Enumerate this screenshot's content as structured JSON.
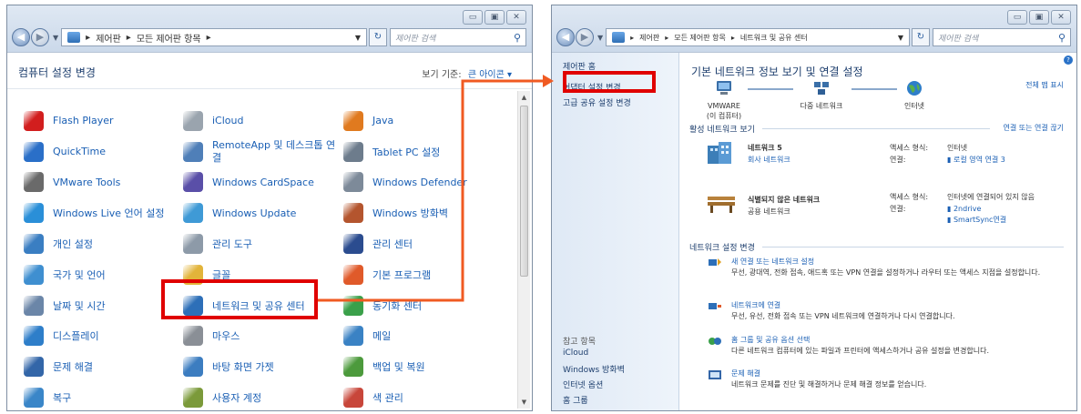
{
  "left_window": {
    "caption_buttons": [
      "▭",
      "▣",
      "✕"
    ],
    "address": {
      "crumbs": [
        "제어판",
        "모든 제어판 항목"
      ],
      "search_placeholder": "제어판 검색"
    },
    "title": "컴퓨터 설정 변경",
    "view_by_label": "보기 기준:",
    "view_by_value": "큰 아이콘 ▾",
    "items": [
      {
        "label": "Flash Player",
        "icon": "flash-player-icon",
        "color": "#d21e1e"
      },
      {
        "label": "iCloud",
        "icon": "icloud-icon",
        "color": "#9aa4ae"
      },
      {
        "label": "Java",
        "icon": "java-icon",
        "color": "#e07a1f"
      },
      {
        "label": "QuickTime",
        "icon": "quicktime-icon",
        "color": "#2a6fc8"
      },
      {
        "label": "RemoteApp 및 데스크톱 연결",
        "icon": "remoteapp-icon",
        "color": "#4f7fb8"
      },
      {
        "label": "Tablet PC 설정",
        "icon": "tablet-pc-icon",
        "color": "#6d7c8c"
      },
      {
        "label": "VMware Tools",
        "icon": "vmware-icon",
        "color": "#6a6a6a"
      },
      {
        "label": "Windows CardSpace",
        "icon": "cardspace-icon",
        "color": "#5a4fa8"
      },
      {
        "label": "Windows Defender",
        "icon": "defender-icon",
        "color": "#7d8a99"
      },
      {
        "label": "Windows Live 언어 설정",
        "icon": "windows-live-icon",
        "color": "#2a8fd8"
      },
      {
        "label": "Windows Update",
        "icon": "windows-update-icon",
        "color": "#3f9ad6"
      },
      {
        "label": "Windows 방화벽",
        "icon": "firewall-icon",
        "color": "#b4552e"
      },
      {
        "label": "개인 설정",
        "icon": "personalization-icon",
        "color": "#3a7ec2"
      },
      {
        "label": "관리 도구",
        "icon": "admin-tools-icon",
        "color": "#8d9aa8"
      },
      {
        "label": "관리 센터",
        "icon": "action-center-icon",
        "color": "#2b4c8f"
      },
      {
        "label": "국가 및 언어",
        "icon": "region-language-icon",
        "color": "#3f8fd0"
      },
      {
        "label": "글꼴",
        "icon": "fonts-icon",
        "color": "#e2b43a"
      },
      {
        "label": "기본 프로그램",
        "icon": "default-programs-icon",
        "color": "#e05a2a"
      },
      {
        "label": "날짜 및 시간",
        "icon": "date-time-icon",
        "color": "#6b86a8"
      },
      {
        "label": "네트워크 및 공유 센터",
        "icon": "network-sharing-icon",
        "color": "#2d6fb8"
      },
      {
        "label": "동기화 센터",
        "icon": "sync-center-icon",
        "color": "#3aa04a"
      },
      {
        "label": "디스플레이",
        "icon": "display-icon",
        "color": "#2e7ec9"
      },
      {
        "label": "마우스",
        "icon": "mouse-icon",
        "color": "#8a8f96"
      },
      {
        "label": "메일",
        "icon": "mail-icon",
        "color": "#3a82c4"
      },
      {
        "label": "문제 해결",
        "icon": "troubleshooting-icon",
        "color": "#3366a8"
      },
      {
        "label": "바탕 화면 가젯",
        "icon": "gadgets-icon",
        "color": "#3c7dc0"
      },
      {
        "label": "백업 및 복원",
        "icon": "backup-restore-icon",
        "color": "#4c9a3c"
      },
      {
        "label": "복구",
        "icon": "recovery-icon",
        "color": "#3a86c8"
      },
      {
        "label": "사용자 계정",
        "icon": "user-accounts-icon",
        "color": "#7b9a3a"
      },
      {
        "label": "색 관리",
        "icon": "color-management-icon",
        "color": "#c8463a"
      }
    ]
  },
  "right_window": {
    "caption_buttons": [
      "▭",
      "▣",
      "✕"
    ],
    "address": {
      "crumbs": [
        "제어판",
        "모든 제어판 항목",
        "네트워크 및 공유 센터"
      ],
      "search_placeholder": "제어판 검색"
    },
    "sidebar": {
      "home": "제어판 홈",
      "adapter_settings": "어댑터 설정 변경",
      "advanced_sharing": "고급 공유 설정 변경",
      "see_also_title": "참고 항목",
      "see_also": [
        "iCloud",
        "Windows 방화벽",
        "인터넷 옵션",
        "홈 그룹"
      ]
    },
    "title": "기본 네트워크 정보 보기 및 연결 설정",
    "full_map": "전체 맵 표시",
    "map": {
      "computer": "VMWARE",
      "computer_sub": "(이 컴퓨터)",
      "network": "다중 네트워크",
      "internet": "인터넷"
    },
    "active_networks_label": "활성 네트워크 보기",
    "connect_disconnect": "연결 또는 연결 끊기",
    "networks": [
      {
        "name": "네트워크 5",
        "type": "회사 네트워크",
        "access_label": "액세스 형식:",
        "access": "인터넷",
        "conn_label": "연결:",
        "conns": [
          "로컬 영역 연결 3"
        ]
      },
      {
        "name": "식별되지 않은 네트워크",
        "type": "공용 네트워크",
        "access_label": "액세스 형식:",
        "access": "인터넷에 연결되어 있지 않음",
        "conn_label": "연결:",
        "conns": [
          "2ndrive",
          "SmartSync연결"
        ]
      }
    ],
    "change_settings_label": "네트워크 설정 변경",
    "tasks": [
      {
        "title": "새 연결 또는 네트워크 설정",
        "desc": "무선, 광대역, 전화 접속, 애드혹 또는 VPN 연결을 설정하거나 라우터 또는 액세스 지점을 설정합니다."
      },
      {
        "title": "네트워크에 연결",
        "desc": "무선, 유선, 전화 접속 또는 VPN 네트워크에 연결하거나 다시 연결합니다."
      },
      {
        "title": "홈 그룹 및 공유 옵션 선택",
        "desc": "다른 네트워크 컴퓨터에 있는 파일과 프린터에 액세스하거나 공유 설정을 변경합니다."
      },
      {
        "title": "문제 해결",
        "desc": "네트워크 문제를 진단 및 해결하거나 문제 해결 정보를 얻습니다."
      }
    ]
  },
  "colors": {
    "highlight": "#e00000",
    "arrow": "#f05a22",
    "link": "#1a5fb4",
    "heading": "#1e3f6e"
  }
}
